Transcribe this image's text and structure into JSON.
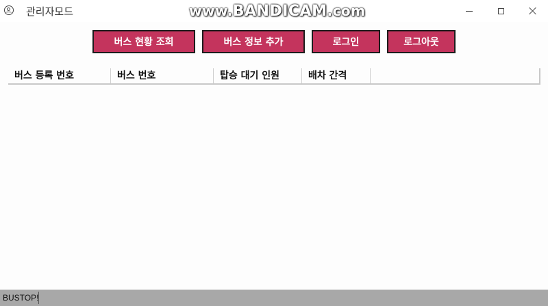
{
  "window": {
    "title": "관리자모드",
    "watermark_prefix": "www.",
    "watermark_brand": "BANDICAM",
    "watermark_suffix": ".com"
  },
  "toolbar": {
    "bus_status_label": "버스 현황 조회",
    "add_bus_label": "버스 정보 추가",
    "login_label": "로그인",
    "logout_label": "로그아웃",
    "button_color": "#c4345d"
  },
  "table": {
    "columns": [
      "버스 등록 번호",
      "버스 번호",
      "탑승 대기 인원",
      "배차 간격"
    ],
    "rows": []
  },
  "statusbar": {
    "text": "BUSTOP!"
  },
  "icons": {
    "app": "user-circle-icon",
    "minimize": "minimize-icon",
    "maximize": "maximize-icon",
    "close": "close-icon"
  }
}
